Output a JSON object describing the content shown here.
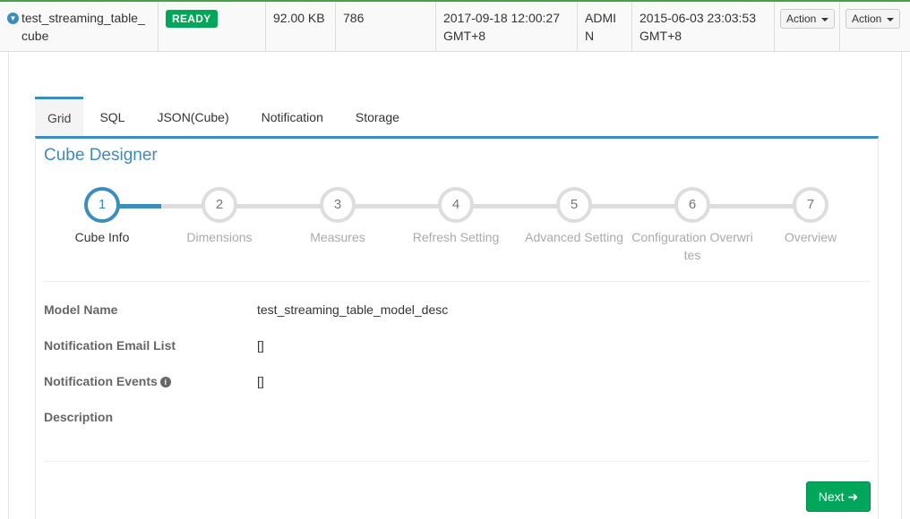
{
  "row": {
    "name": "test_streaming_table_cube",
    "status": "READY",
    "size": "92.00 KB",
    "source_records": "786",
    "last_build_time": "2017-09-18 12:00:27 GMT+8",
    "owner": "ADMIN",
    "create_time": "2015-06-03 23:03:53 GMT+8",
    "action_label_1": "Action",
    "action_label_2": "Action"
  },
  "tabs": [
    {
      "label": "Grid",
      "active": true
    },
    {
      "label": "SQL"
    },
    {
      "label": "JSON(Cube)"
    },
    {
      "label": "Notification"
    },
    {
      "label": "Storage"
    }
  ],
  "designer": {
    "title": "Cube Designer",
    "steps": [
      {
        "number": "1",
        "label": "Cube Info",
        "active": true
      },
      {
        "number": "2",
        "label": "Dimensions"
      },
      {
        "number": "3",
        "label": "Measures"
      },
      {
        "number": "4",
        "label": "Refresh Setting"
      },
      {
        "number": "5",
        "label": "Advanced Setting"
      },
      {
        "number": "6",
        "label": "Configuration Overwrites"
      },
      {
        "number": "7",
        "label": "Overview"
      }
    ],
    "fields": [
      {
        "label": "Model Name",
        "value": "test_streaming_table_model_desc"
      },
      {
        "label": "Notification Email List",
        "value": "[]"
      },
      {
        "label": "Notification Events",
        "value": "[]"
      },
      {
        "label": "Description",
        "value": ""
      }
    ],
    "next_label": "Next"
  },
  "colors": {
    "primary": "#3c8dbc",
    "success": "#00a65a",
    "row_accent": "#4b9e4b"
  },
  "icons": {
    "expand": "chevron-down-icon",
    "info": "info-circle-icon",
    "next": "arrow-right-icon"
  }
}
